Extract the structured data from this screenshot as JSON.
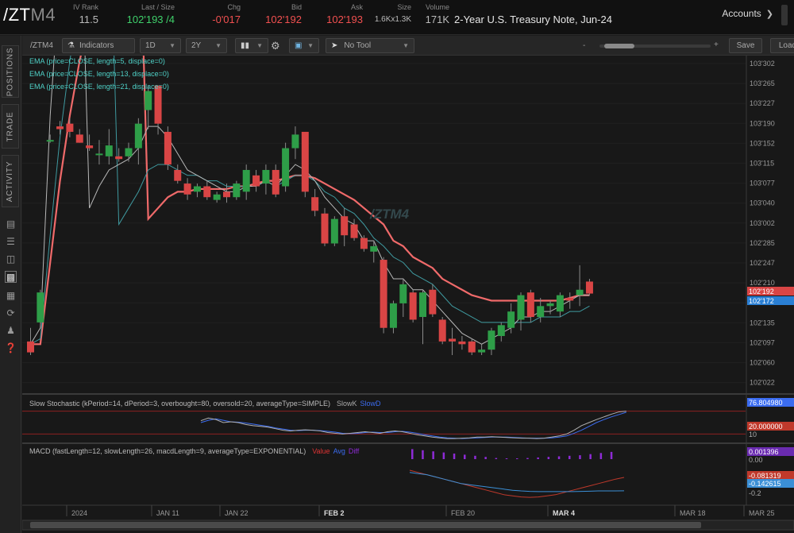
{
  "header": {
    "symbol_main": "/ZT",
    "symbol_suffix": "M4",
    "iv_rank": {
      "label": "IV Rank",
      "value": "11.5"
    },
    "last_size": {
      "label": "Last / Size",
      "value": "102'193 /4"
    },
    "chg": {
      "label": "Chg",
      "value": "-0'017"
    },
    "bid": {
      "label": "Bid",
      "value": "102'192"
    },
    "ask": {
      "label": "Ask",
      "value": "102'193"
    },
    "size": {
      "label": "Size",
      "value": "1.6Kx1.3K"
    },
    "volume": {
      "label": "Volume",
      "value": "171K"
    },
    "description": "2-Year U.S. Treasury Note, Jun-24",
    "accounts_label": "Accounts"
  },
  "left_tabs": [
    "POSITIONS",
    "TRADE",
    "ACTIVITY"
  ],
  "left_icons": [
    "news-icon",
    "list-icon",
    "layers-icon",
    "chart-icon",
    "grid-icon",
    "refresh-icon",
    "people-icon",
    "help-icon"
  ],
  "toolbar": {
    "symbol": "/ZTM4",
    "indicators": "Indicators",
    "aggregation": "1D",
    "timeframe": "2Y",
    "tool": "No Tool",
    "dash": "-",
    "plus": "+",
    "save": "Save",
    "load": "Load"
  },
  "studies": {
    "ema1": "EMA (price=CLOSE, length=5, displace=0)",
    "ema2": "EMA (price=CLOSE, length=13, displace=0)",
    "ema3": "EMA (price=CLOSE, length=21, displace=0)",
    "stoch": "Slow Stochastic (kPeriod=14, dPeriod=3, overbought=80, oversold=20, averageType=SIMPLE)",
    "stoch_k": "SlowK",
    "stoch_d": "SlowD",
    "macd": "MACD (fastLength=12, slowLength=26, macdLength=9, averageType=EXPONENTIAL)",
    "macd_value": "Value",
    "macd_avg": "Avg",
    "macd_diff": "Diff"
  },
  "watermark": "/ZTM4",
  "colors": {
    "up": "#2e9e48",
    "down": "#d94545",
    "ema5": "#b8b8b8",
    "ema13": "#3f9aa0",
    "ema21": "#f06a6a",
    "stoch_k": "#b0b0b0",
    "stoch_d": "#3b6cf0",
    "macd_value": "#c0392b",
    "macd_avg": "#3b8fd6",
    "macd_diff": "#8e2bd6"
  },
  "chart_data": {
    "type": "candlestick",
    "price_axis_labels": [
      "103'302",
      "103'265",
      "103'227",
      "103'190",
      "103'152",
      "103'115",
      "103'077",
      "103'040",
      "103'002",
      "102'285",
      "102'247",
      "102'210",
      "102'172",
      "102'135",
      "102'097",
      "102'060",
      "102'022"
    ],
    "price_badges": [
      {
        "label": "102'192",
        "color": "#d94545"
      },
      {
        "label": "102'172",
        "color": "#2a7fd4"
      }
    ],
    "date_labels": [
      "2024",
      "JAN 11",
      "JAN 22",
      "FEB 2",
      "FEB 20",
      "MAR 4",
      "MAR 18",
      "MAR 25"
    ],
    "candles": [
      {
        "o": 102.105,
        "h": 102.13,
        "l": 102.08,
        "c": 102.085
      },
      {
        "o": 102.14,
        "h": 102.2,
        "l": 102.135,
        "c": 102.195
      },
      {
        "o": 103.155,
        "h": 103.165,
        "l": 103.15,
        "c": 103.155
      },
      {
        "o": 103.18,
        "h": 103.19,
        "l": 103.165,
        "c": 103.175
      },
      {
        "o": 103.185,
        "h": 103.195,
        "l": 103.16,
        "c": 103.17
      },
      {
        "o": 103.165,
        "h": 103.175,
        "l": 103.15,
        "c": 103.15
      },
      {
        "o": 103.145,
        "h": 103.165,
        "l": 103.135,
        "c": 103.14
      },
      {
        "o": 103.128,
        "h": 103.155,
        "l": 103.11,
        "c": 103.13
      },
      {
        "o": 103.125,
        "h": 103.175,
        "l": 103.11,
        "c": 103.145
      },
      {
        "o": 103.125,
        "h": 103.14,
        "l": 103.115,
        "c": 103.12
      },
      {
        "o": 103.125,
        "h": 103.15,
        "l": 103.115,
        "c": 103.14
      },
      {
        "o": 103.14,
        "h": 103.195,
        "l": 103.11,
        "c": 103.185
      },
      {
        "o": 103.21,
        "h": 103.255,
        "l": 103.175,
        "c": 103.245
      },
      {
        "o": 103.255,
        "h": 103.255,
        "l": 103.165,
        "c": 103.185
      },
      {
        "o": 103.17,
        "h": 103.18,
        "l": 103.1,
        "c": 103.11
      },
      {
        "o": 103.1,
        "h": 103.11,
        "l": 103.075,
        "c": 103.08
      },
      {
        "o": 103.075,
        "h": 103.085,
        "l": 103.045,
        "c": 103.055
      },
      {
        "o": 103.06,
        "h": 103.075,
        "l": 103.05,
        "c": 103.07
      },
      {
        "o": 103.07,
        "h": 103.08,
        "l": 103.045,
        "c": 103.05
      },
      {
        "o": 103.045,
        "h": 103.06,
        "l": 103.04,
        "c": 103.055
      },
      {
        "o": 103.06,
        "h": 103.075,
        "l": 103.04,
        "c": 103.05
      },
      {
        "o": 103.05,
        "h": 103.08,
        "l": 103.045,
        "c": 103.075
      },
      {
        "o": 103.06,
        "h": 103.11,
        "l": 103.045,
        "c": 103.1
      },
      {
        "o": 103.09,
        "h": 103.1,
        "l": 103.06,
        "c": 103.07
      },
      {
        "o": 103.075,
        "h": 103.11,
        "l": 103.055,
        "c": 103.1
      },
      {
        "o": 103.1,
        "h": 103.11,
        "l": 103.05,
        "c": 103.055
      },
      {
        "o": 103.07,
        "h": 103.15,
        "l": 103.06,
        "c": 103.14
      },
      {
        "o": 103.14,
        "h": 103.18,
        "l": 103.12,
        "c": 103.165
      },
      {
        "o": 103.17,
        "h": 103.17,
        "l": 103.05,
        "c": 103.06
      },
      {
        "o": 103.05,
        "h": 103.065,
        "l": 103.015,
        "c": 103.025
      },
      {
        "o": 103.02,
        "h": 103.03,
        "l": 102.28,
        "c": 102.285
      },
      {
        "o": 102.285,
        "h": 103.015,
        "l": 102.28,
        "c": 103.01
      },
      {
        "o": 103.015,
        "h": 103.03,
        "l": 102.28,
        "c": 102.3
      },
      {
        "o": 103.0,
        "h": 103.01,
        "l": 102.29,
        "c": 102.295
      },
      {
        "o": 102.295,
        "h": 102.3,
        "l": 102.27,
        "c": 102.275
      },
      {
        "o": 102.27,
        "h": 102.29,
        "l": 102.25,
        "c": 102.28
      },
      {
        "o": 102.255,
        "h": 102.26,
        "l": 102.12,
        "c": 102.13
      },
      {
        "o": 102.13,
        "h": 102.18,
        "l": 102.12,
        "c": 102.175
      },
      {
        "o": 102.175,
        "h": 102.22,
        "l": 102.15,
        "c": 102.21
      },
      {
        "o": 102.195,
        "h": 102.2,
        "l": 102.14,
        "c": 102.145
      },
      {
        "o": 102.15,
        "h": 102.2,
        "l": 102.1,
        "c": 102.195
      },
      {
        "o": 102.2,
        "h": 102.21,
        "l": 102.15,
        "c": 102.155
      },
      {
        "o": 102.145,
        "h": 102.15,
        "l": 102.1,
        "c": 102.105
      },
      {
        "o": 102.11,
        "h": 102.13,
        "l": 102.08,
        "c": 102.105
      },
      {
        "o": 102.105,
        "h": 102.115,
        "l": 102.09,
        "c": 102.1
      },
      {
        "o": 102.105,
        "h": 102.11,
        "l": 102.08,
        "c": 102.085
      },
      {
        "o": 102.085,
        "h": 102.1,
        "l": 102.08,
        "c": 102.09
      },
      {
        "o": 102.09,
        "h": 102.13,
        "l": 102.08,
        "c": 102.125
      },
      {
        "o": 102.115,
        "h": 102.14,
        "l": 102.105,
        "c": 102.135
      },
      {
        "o": 102.13,
        "h": 102.175,
        "l": 102.12,
        "c": 102.16
      },
      {
        "o": 102.145,
        "h": 102.195,
        "l": 102.125,
        "c": 102.19
      },
      {
        "o": 102.195,
        "h": 102.2,
        "l": 102.14,
        "c": 102.15
      },
      {
        "o": 102.15,
        "h": 102.185,
        "l": 102.14,
        "c": 102.17
      },
      {
        "o": 102.17,
        "h": 102.18,
        "l": 102.155,
        "c": 102.175
      },
      {
        "o": 102.16,
        "h": 102.195,
        "l": 102.15,
        "c": 102.19
      },
      {
        "o": 102.185,
        "h": 102.195,
        "l": 102.165,
        "c": 102.18
      },
      {
        "o": 102.19,
        "h": 102.245,
        "l": 102.17,
        "c": 102.2
      },
      {
        "o": 102.215,
        "h": 102.22,
        "l": 102.19,
        "c": 102.193
      }
    ],
    "ema5": [
      102.1,
      102.13,
      102.52,
      102.78,
      102.91,
      102.98,
      103.03,
      103.07,
      103.1,
      103.11,
      103.12,
      103.14,
      103.18,
      103.18,
      103.16,
      103.13,
      103.1,
      103.09,
      103.08,
      103.07,
      103.06,
      103.06,
      103.07,
      103.07,
      103.08,
      103.07,
      103.09,
      103.11,
      103.1,
      103.08,
      103.05,
      103.03,
      103.01,
      103.0,
      102.29,
      102.29,
      102.25,
      102.22,
      102.22,
      102.2,
      102.2,
      102.18,
      102.16,
      102.14,
      102.12,
      102.11,
      102.1,
      102.11,
      102.12,
      102.13,
      102.15,
      102.15,
      102.16,
      102.16,
      102.17,
      102.18,
      102.19,
      102.19
    ],
    "ema13": [
      102.1,
      102.11,
      102.3,
      102.48,
      102.62,
      102.73,
      102.82,
      102.9,
      102.96,
      103.0,
      103.03,
      103.06,
      103.1,
      103.11,
      103.11,
      103.1,
      103.09,
      103.09,
      103.08,
      103.08,
      103.07,
      103.07,
      103.07,
      103.07,
      103.08,
      103.07,
      103.08,
      103.09,
      103.09,
      103.08,
      103.06,
      103.05,
      103.03,
      103.02,
      103.0,
      102.295,
      102.28,
      102.26,
      102.25,
      102.23,
      102.22,
      102.21,
      102.19,
      102.17,
      102.16,
      102.15,
      102.14,
      102.14,
      102.14,
      102.14,
      102.14,
      102.14,
      102.15,
      102.15,
      102.15,
      102.16,
      102.16,
      102.17
    ],
    "ema21": [
      102.1,
      102.1,
      102.25,
      102.4,
      102.52,
      102.62,
      102.7,
      102.78,
      102.84,
      102.89,
      102.93,
      102.97,
      103.01,
      103.03,
      103.05,
      103.06,
      103.06,
      103.065,
      103.065,
      103.065,
      103.065,
      103.07,
      103.07,
      103.075,
      103.08,
      103.08,
      103.085,
      103.09,
      103.09,
      103.085,
      103.075,
      103.065,
      103.055,
      103.045,
      103.03,
      103.015,
      103.0,
      102.29,
      102.28,
      102.26,
      102.25,
      102.24,
      102.22,
      102.21,
      102.2,
      102.19,
      102.185,
      102.18,
      102.18,
      102.18,
      102.18,
      102.18,
      102.18,
      102.18,
      102.18,
      102.185,
      102.19,
      102.19
    ],
    "stoch_labels": [
      "76.804980",
      "20.000000",
      "10"
    ],
    "stoch_k": [
      55,
      62,
      58,
      50,
      52,
      50,
      45,
      42,
      40,
      38,
      34,
      30,
      28,
      30,
      31,
      30,
      28,
      24,
      22,
      20,
      22,
      24,
      26,
      24,
      22,
      26,
      28,
      26,
      22,
      18,
      15,
      12,
      10,
      8,
      8,
      9,
      10,
      12,
      12,
      13,
      12,
      11,
      10,
      9,
      9,
      8,
      9,
      12,
      15,
      20,
      30,
      42,
      50,
      58,
      65,
      72,
      78,
      80
    ],
    "stoch_d": [
      50,
      56,
      60,
      56,
      52,
      51,
      49,
      46,
      43,
      40,
      36,
      33,
      30,
      29,
      30,
      30,
      29,
      27,
      25,
      22,
      21,
      22,
      24,
      25,
      24,
      24,
      26,
      27,
      25,
      22,
      18,
      15,
      12,
      10,
      9,
      8,
      9,
      10,
      11,
      12,
      12,
      12,
      11,
      10,
      9,
      9,
      9,
      10,
      12,
      15,
      22,
      30,
      40,
      50,
      58,
      65,
      71,
      77
    ],
    "macd_labels": [
      "0.001396",
      "0.00",
      "-0.081319",
      "-0.142615",
      "-0.2"
    ],
    "macd_value": [
      -0.05,
      -0.06,
      -0.07,
      -0.08,
      -0.09,
      -0.1,
      -0.11,
      -0.12,
      -0.13,
      -0.14,
      -0.15,
      -0.16,
      -0.165,
      -0.17,
      -0.172,
      -0.17,
      -0.165,
      -0.16,
      -0.15,
      -0.14,
      -0.13,
      -0.12,
      -0.11,
      -0.1,
      -0.09,
      -0.082
    ],
    "macd_avg": [
      -0.06,
      -0.065,
      -0.07,
      -0.08,
      -0.09,
      -0.1,
      -0.11,
      -0.115,
      -0.12,
      -0.125,
      -0.13,
      -0.135,
      -0.14,
      -0.143,
      -0.145,
      -0.146,
      -0.146,
      -0.146,
      -0.146,
      -0.146,
      -0.145,
      -0.144,
      -0.143,
      -0.143,
      -0.143,
      -0.1426
    ],
    "macd_diff": [
      0.018,
      0.016,
      0.014,
      0.012,
      0.01,
      0.008,
      0.006,
      0.004,
      0.002,
      0.001,
      0.001,
      0.002,
      0.003,
      0.004,
      0.005,
      0.006,
      0.007,
      0.009,
      0.011,
      0.013
    ]
  }
}
